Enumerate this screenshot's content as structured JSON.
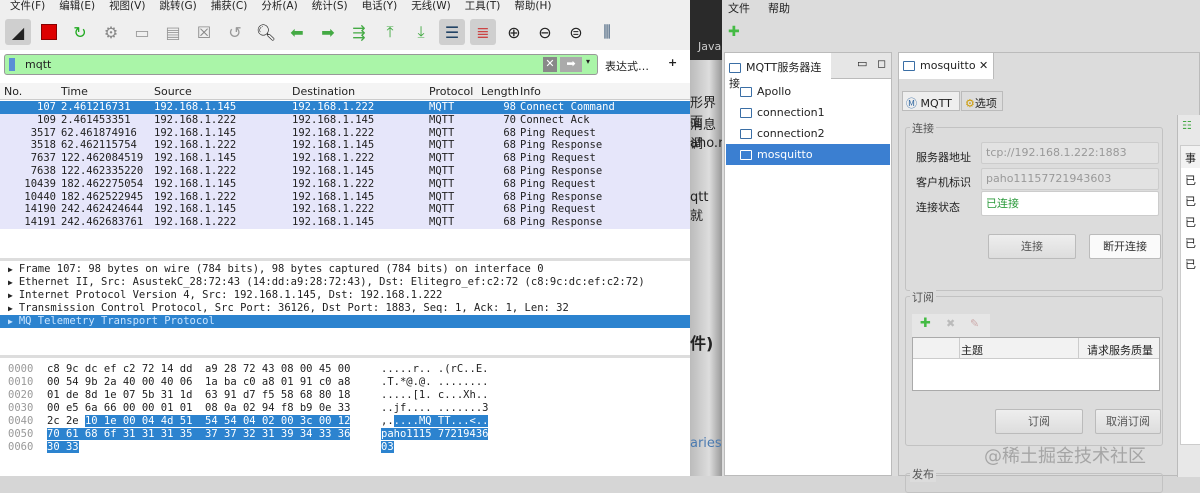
{
  "wireshark": {
    "menu": [
      "文件(F)",
      "编辑(E)",
      "视图(V)",
      "跳转(G)",
      "捕获(C)",
      "分析(A)",
      "统计(S)",
      "电话(Y)",
      "无线(W)",
      "工具(T)",
      "帮助(H)"
    ],
    "filter": {
      "value": "mqtt",
      "expression_label": "表达式…",
      "add_label": "+"
    },
    "columns": [
      "No.",
      "Time",
      "Source",
      "Destination",
      "Protocol",
      "Length",
      "Info"
    ],
    "packets": [
      [
        "107",
        "2.461216731",
        "192.168.1.145",
        "192.168.1.222",
        "MQTT",
        "98",
        "Connect Command"
      ],
      [
        "109",
        "2.461453351",
        "192.168.1.222",
        "192.168.1.145",
        "MQTT",
        "70",
        "Connect Ack"
      ],
      [
        "3517",
        "62.461874916",
        "192.168.1.145",
        "192.168.1.222",
        "MQTT",
        "68",
        "Ping Request"
      ],
      [
        "3518",
        "62.462115754",
        "192.168.1.222",
        "192.168.1.145",
        "MQTT",
        "68",
        "Ping Response"
      ],
      [
        "7637",
        "122.462084519",
        "192.168.1.145",
        "192.168.1.222",
        "MQTT",
        "68",
        "Ping Request"
      ],
      [
        "7638",
        "122.462335220",
        "192.168.1.222",
        "192.168.1.145",
        "MQTT",
        "68",
        "Ping Response"
      ],
      [
        "10439",
        "182.462275054",
        "192.168.1.145",
        "192.168.1.222",
        "MQTT",
        "68",
        "Ping Request"
      ],
      [
        "10440",
        "182.462522945",
        "192.168.1.222",
        "192.168.1.145",
        "MQTT",
        "68",
        "Ping Response"
      ],
      [
        "14190",
        "242.462424644",
        "192.168.1.145",
        "192.168.1.222",
        "MQTT",
        "68",
        "Ping Request"
      ],
      [
        "14191",
        "242.462683761",
        "192.168.1.222",
        "192.168.1.145",
        "MQTT",
        "68",
        "Ping Response"
      ]
    ],
    "details": [
      "Frame 107: 98 bytes on wire (784 bits), 98 bytes captured (784 bits) on interface 0",
      "Ethernet II, Src: AsustekC_28:72:43 (14:dd:a9:28:72:43), Dst: Elitegro_ef:c2:72 (c8:9c:dc:ef:c2:72)",
      "Internet Protocol Version 4, Src: 192.168.1.145, Dst: 192.168.1.222",
      "Transmission Control Protocol, Src Port: 36126, Dst Port: 1883, Seq: 1, Ack: 1, Len: 32",
      "MQ Telemetry Transport Protocol"
    ],
    "hex": [
      {
        "off": "0000",
        "pre": "c8 9c dc ef c2 72 14 dd  a9 28 72 43 08 00 45 00",
        "hl": "",
        "ascii_pre": ".....r.. .(rC..E.",
        "ascii_hl": ""
      },
      {
        "off": "0010",
        "pre": "00 54 9b 2a 40 00 40 06  1a ba c0 a8 01 91 c0 a8",
        "hl": "",
        "ascii_pre": ".T.*@.@. ........",
        "ascii_hl": ""
      },
      {
        "off": "0020",
        "pre": "01 de 8d 1e 07 5b 31 1d  63 91 d7 f5 58 68 80 18",
        "hl": "",
        "ascii_pre": ".....[1. c...Xh..",
        "ascii_hl": ""
      },
      {
        "off": "0030",
        "pre": "00 e5 6a 66 00 00 01 01  08 0a 02 94 f8 b9 0e 33",
        "hl": "",
        "ascii_pre": "..jf.... .......3",
        "ascii_hl": ""
      },
      {
        "off": "0040",
        "pre": "2c 2e ",
        "hl": "10 1e 00 04 4d 51  54 54 04 02 00 3c 00 12",
        "ascii_pre": ",.",
        "ascii_hl": "....MQ TT...<.."
      },
      {
        "off": "0050",
        "pre": "",
        "hl": "70 61 68 6f 31 31 31 35  37 37 32 31 39 34 33 36",
        "ascii_pre": "",
        "ascii_hl": "paho1115 77219436"
      },
      {
        "off": "0060",
        "pre": "",
        "hl": "30 33",
        "ascii_pre": "",
        "ascii_hl": "03"
      }
    ]
  },
  "background": {
    "tab": "Java",
    "fragments": [
      "形界面",
      "消息调",
      "aho.n",
      "qtt 就",
      "件)",
      "aries"
    ]
  },
  "eclipse": {
    "menu": [
      "文件",
      "帮助"
    ],
    "connections_view": {
      "title": "MQTT服务器连接",
      "items": [
        "Apollo",
        "connection1",
        "connection2",
        "mosquitto"
      ],
      "selected": "mosquitto"
    },
    "editor": {
      "tab": "mosquitto",
      "subtabs": [
        "MQTT",
        "选项"
      ],
      "connect_group": {
        "title": "连接",
        "server_label": "服务器地址",
        "server_value": "tcp://192.168.1.222:1883",
        "client_label": "客户机标识",
        "client_value": "paho11157721943603",
        "status_label": "连接状态",
        "status_value": "已连接",
        "connect_btn": "连接",
        "disconnect_btn": "断开连接"
      },
      "subscribe_group": {
        "title": "订阅",
        "columns": [
          "",
          "主题",
          "请求服务质量"
        ],
        "subscribe_btn": "订阅",
        "unsubscribe_btn": "取消订阅"
      },
      "publish_group": {
        "title": "发布"
      }
    },
    "side_panel": {
      "header": "事",
      "rows": [
        "已",
        "已",
        "已",
        "已",
        "已"
      ]
    },
    "status_color": "#2a9a3a"
  },
  "watermark": "@稀土掘金技术社区"
}
